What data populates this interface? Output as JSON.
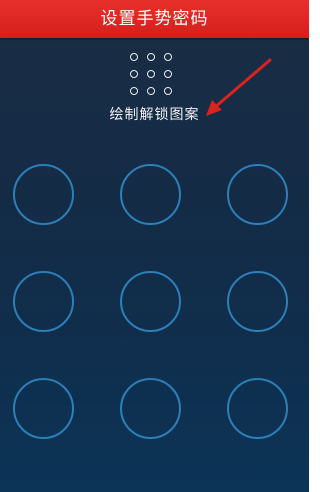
{
  "header": {
    "title": "设置手势密码",
    "background_color": "#e02a26"
  },
  "pattern_preview": {
    "icon": "nine-dot-pattern-icon",
    "rows": 3,
    "cols": 3,
    "dot_color": "#e8eef5"
  },
  "instruction": {
    "text": "绘制解锁图案"
  },
  "annotation": {
    "icon": "red-arrow-icon",
    "color": "#d9231f"
  },
  "gesture_grid": {
    "rows": 3,
    "cols": 3,
    "circle_color": "#2c7fb8",
    "nodes": [
      1,
      2,
      3,
      4,
      5,
      6,
      7,
      8,
      9
    ]
  }
}
